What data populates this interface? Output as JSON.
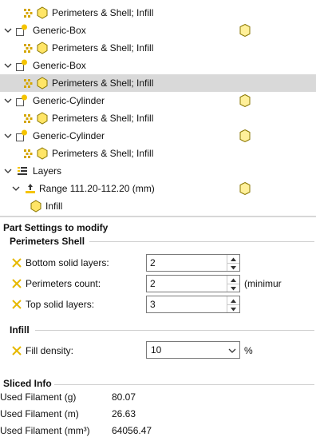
{
  "tree": {
    "rows": [
      {
        "label": "Perimeters & Shell; Infill",
        "kind": "settings",
        "selected": false
      },
      {
        "label": "Generic-Box",
        "kind": "object",
        "selected": false
      },
      {
        "label": "Perimeters & Shell; Infill",
        "kind": "settings",
        "selected": false
      },
      {
        "label": "Generic-Box",
        "kind": "object",
        "selected": false
      },
      {
        "label": "Perimeters & Shell; Infill",
        "kind": "settings",
        "selected": true
      },
      {
        "label": "Generic-Cylinder",
        "kind": "object",
        "selected": false
      },
      {
        "label": "Perimeters & Shell; Infill",
        "kind": "settings",
        "selected": false
      },
      {
        "label": "Generic-Cylinder",
        "kind": "object",
        "selected": false
      },
      {
        "label": "Perimeters & Shell; Infill",
        "kind": "settings",
        "selected": false
      },
      {
        "label": "Layers",
        "kind": "layers",
        "selected": false
      },
      {
        "label": "Range 111.20-112.20 (mm)",
        "kind": "range",
        "selected": false
      },
      {
        "label": "Infill",
        "kind": "leaf",
        "selected": false
      }
    ]
  },
  "part_settings": {
    "title": "Part Settings to modify",
    "perimeters_group": "Perimeters  Shell",
    "fields": [
      {
        "label": "Bottom solid layers:",
        "value": "2",
        "suffix": ""
      },
      {
        "label": "Perimeters count:",
        "value": "2",
        "suffix": "(minimur"
      },
      {
        "label": "Top solid layers:",
        "value": "3",
        "suffix": ""
      }
    ],
    "infill_group": "Infill",
    "infill_field": {
      "label": "Fill density:",
      "value": "10",
      "suffix": "%"
    }
  },
  "sliced_info": {
    "title": "Sliced Info",
    "rows": [
      {
        "label": "Used Filament (g)",
        "value": "80.07"
      },
      {
        "label": "Used Filament (m)",
        "value": "26.63"
      },
      {
        "label": "Used Filament (mm³)",
        "value": "64056.47"
      }
    ]
  },
  "colors": {
    "accent_yellow": "#f5c400",
    "selection": "#d9d9d9"
  }
}
